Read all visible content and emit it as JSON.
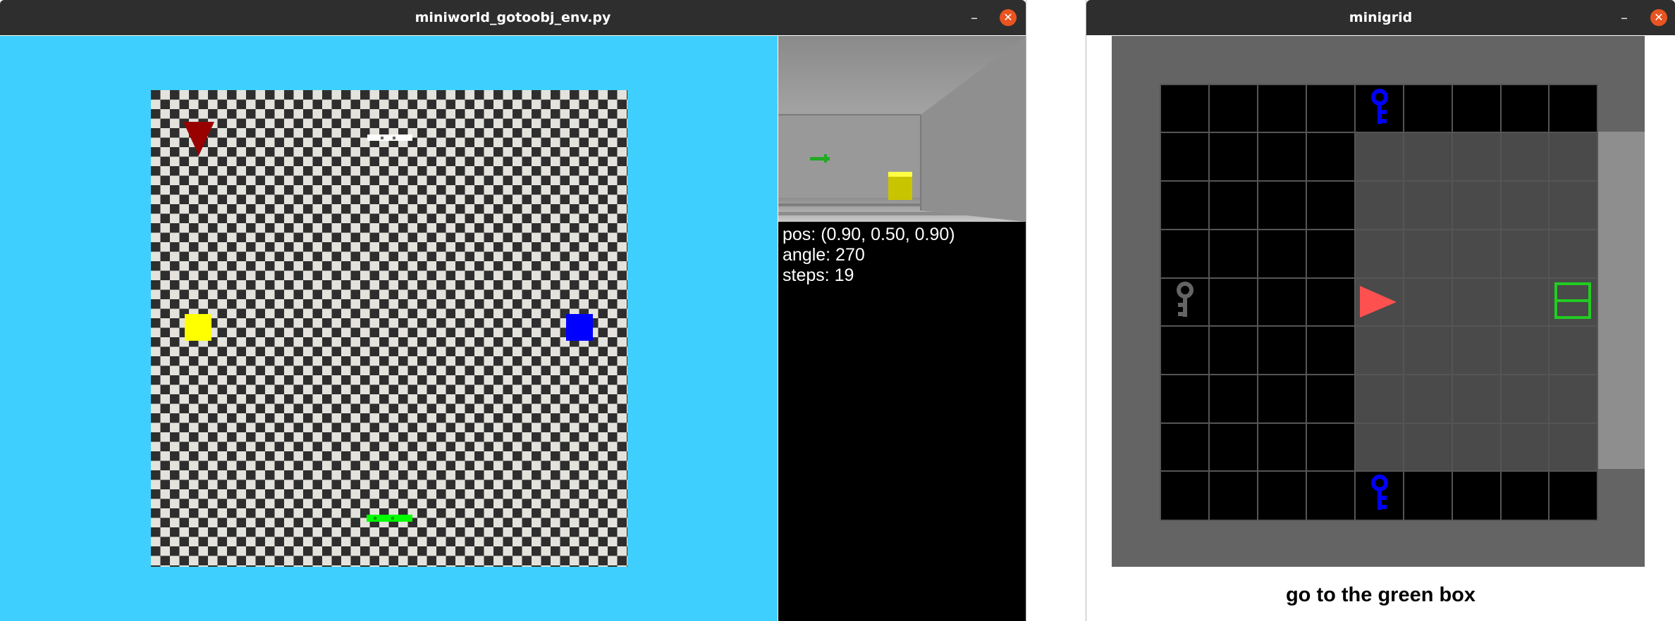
{
  "windows": {
    "miniworld": {
      "title": "miniworld_gotoobj_env.py",
      "minimize_icon": "minimize-icon",
      "close_icon": "close-icon",
      "top_view": {
        "background_color": "#3fcfff",
        "floor_pattern": "checkerboard",
        "objects": [
          {
            "name": "agent",
            "shape": "triangle",
            "color": "#990000",
            "facing": "down"
          },
          {
            "name": "white key",
            "shape": "key",
            "color": "#ffffff"
          },
          {
            "name": "yellow box",
            "shape": "box",
            "color": "#ffff00"
          },
          {
            "name": "blue box",
            "shape": "box",
            "color": "#0000ff"
          },
          {
            "name": "green key",
            "shape": "key",
            "color": "#00ff00"
          }
        ]
      },
      "agent_view": {
        "info": {
          "pos": "pos: (0.90, 0.50, 0.90)",
          "angle": "angle: 270",
          "steps": "steps: 19"
        }
      }
    },
    "minigrid": {
      "title": "minigrid",
      "minimize_icon": "minimize-icon",
      "close_icon": "close-icon",
      "mission": "go to the green box",
      "grid": {
        "objects": [
          {
            "name": "blue key",
            "color": "#0000ff"
          },
          {
            "name": "grey key",
            "color": "#646464"
          },
          {
            "name": "agent",
            "color": "#ff0000",
            "facing": "right"
          },
          {
            "name": "green box",
            "color": "#00ff00"
          },
          {
            "name": "blue key",
            "color": "#0000ff"
          }
        ]
      }
    }
  }
}
